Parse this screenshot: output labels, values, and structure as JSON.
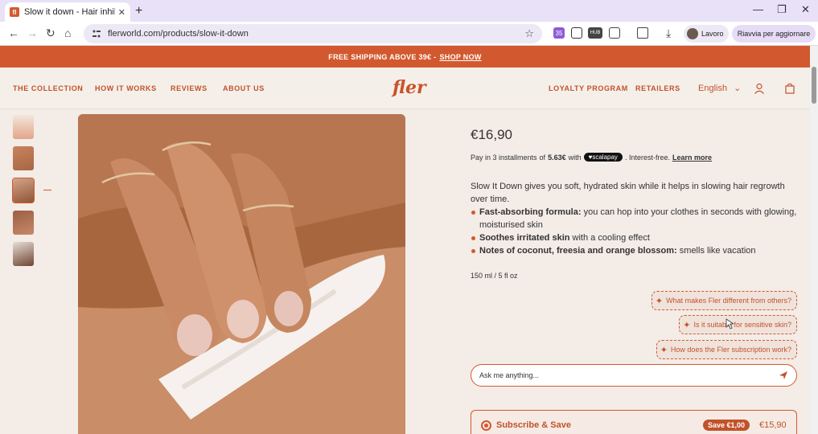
{
  "browser": {
    "tab_title": "Slow it down - Hair inhibiting b",
    "favicon_letter": "fl",
    "url": "flerworld.com/products/slow-it-down",
    "extension_badge": "35",
    "extension_hub": "HUB",
    "profile_name": "Lavoro",
    "update_label": "Riavvia per aggiornare",
    "accent": "#e8e1f7"
  },
  "promo": {
    "text": "FREE SHIPPING ABOVE 39€ -",
    "link": "SHOP NOW"
  },
  "nav": {
    "links_left": [
      "THE COLLECTION",
      "HOW IT WORKS",
      "REVIEWS",
      "ABOUT US"
    ],
    "logo": "fler",
    "links_right": [
      "LOYALTY PROGRAM",
      "RETAILERS"
    ],
    "language": "English"
  },
  "product": {
    "price": "€16,90",
    "installments": {
      "prefix": "Pay in 3 installments",
      "of": "of",
      "amount": "5.63€",
      "with": "with",
      "provider": "scalapay",
      "suffix": ". Interest-free.",
      "link": "Learn more"
    },
    "description": "Slow It Down gives you soft, hydrated skin while it helps in slowing hair regrowth over time.",
    "bullets": [
      {
        "bold": "Fast-absorbing formula:",
        "text": " you can hop into your clothes in seconds with glowing, moisturised skin"
      },
      {
        "bold": "Soothes irritated skin",
        "text": " with a cooling effect"
      },
      {
        "bold": "Notes of coconut, freesia and orange blossom:",
        "text": " smells like vacation"
      }
    ],
    "size": "150 ml / 5 fl oz"
  },
  "assistant": {
    "chips": [
      "What makes Fler different from others?",
      "Is it suitable for sensitive skin?",
      "How does the Fler subscription work?"
    ],
    "placeholder": "Ask me anything..."
  },
  "subscribe": {
    "label": "Subscribe & Save",
    "badge": "Save €1,00",
    "price": "€15,90"
  },
  "colors": {
    "brand": "#d2592f",
    "background": "#f3ece7"
  }
}
